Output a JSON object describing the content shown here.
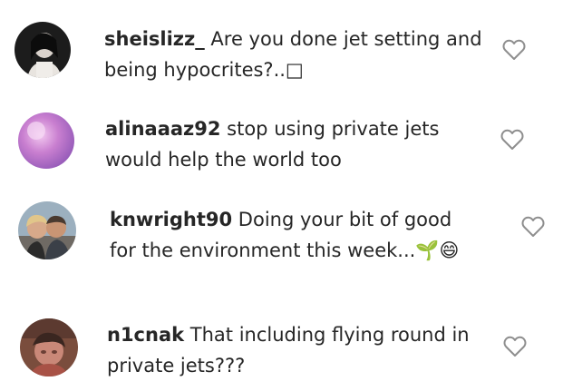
{
  "comments": [
    {
      "username": "sheislizz_",
      "text": " Are you done jet setting and being hypocrites?..□",
      "like_icon": "heart-outline-icon"
    },
    {
      "username": "alinaaaz92",
      "text": " stop using private jets would help the world too",
      "like_icon": "heart-outline-icon"
    },
    {
      "username": "knwright90",
      "text": " Doing your bit of good for the environment this week...🌱😄",
      "like_icon": "heart-outline-icon"
    },
    {
      "username": "n1cnak",
      "text": " That including flying round in private jets???",
      "like_icon": "heart-outline-icon"
    }
  ]
}
